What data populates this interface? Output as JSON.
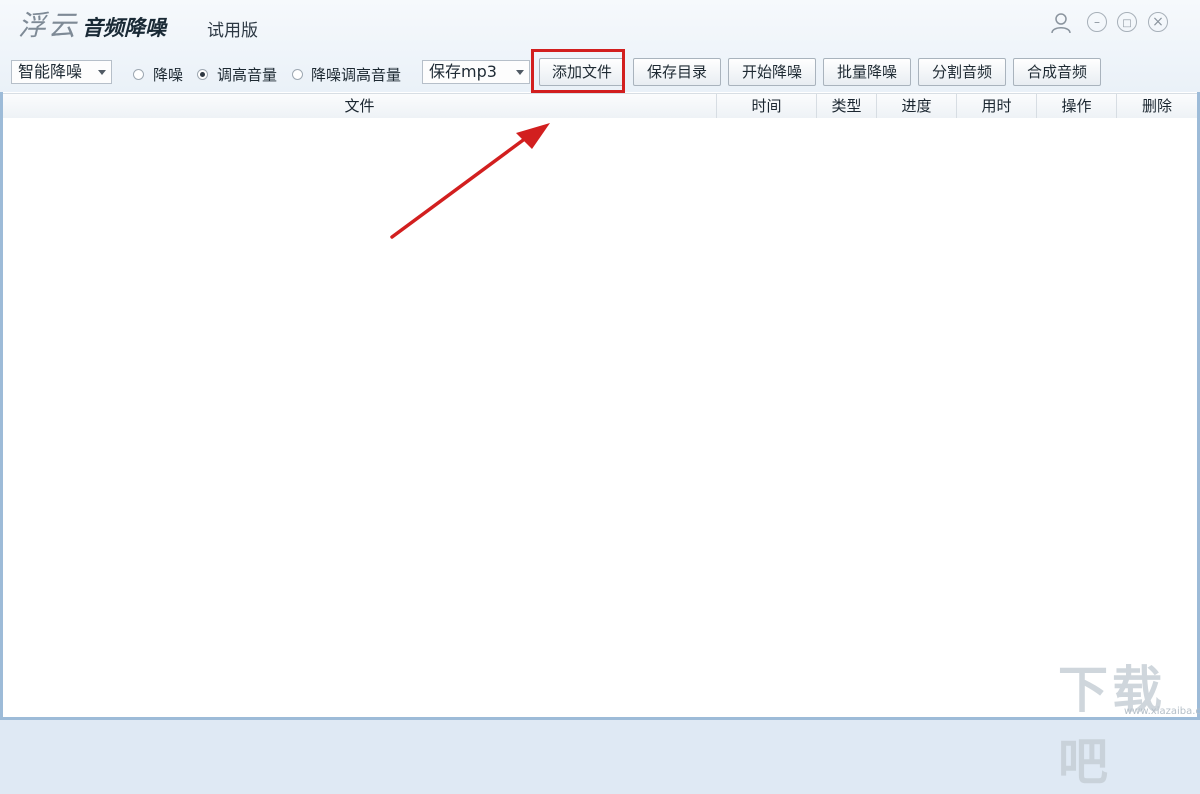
{
  "title_bar": {
    "brand": "浮云",
    "app_name": "音频降噪",
    "edition": "试用版",
    "controls": {
      "user": "user-icon",
      "minimize": "–",
      "maximize": "□",
      "close": "×"
    }
  },
  "toolbar": {
    "mode_select": {
      "value": "智能降噪"
    },
    "radios": [
      {
        "label": "降噪",
        "checked": false
      },
      {
        "label": "调高音量",
        "checked": true
      },
      {
        "label": "降噪调高音量",
        "checked": false
      }
    ],
    "format_select": {
      "value": "保存mp3"
    },
    "buttons": {
      "add_file": "添加文件",
      "save_dir": "保存目录",
      "start_denoise": "开始降噪",
      "batch_denoise": "批量降噪",
      "split_audio": "分割音频",
      "merge_audio": "合成音频"
    }
  },
  "table": {
    "columns": [
      "文件",
      "时间",
      "类型",
      "进度",
      "用时",
      "操作",
      "删除"
    ],
    "rows": []
  },
  "annotation": {
    "color": "#d21f1f"
  },
  "watermark": {
    "text": "下载吧",
    "url": "www.xiazaiba.com"
  }
}
